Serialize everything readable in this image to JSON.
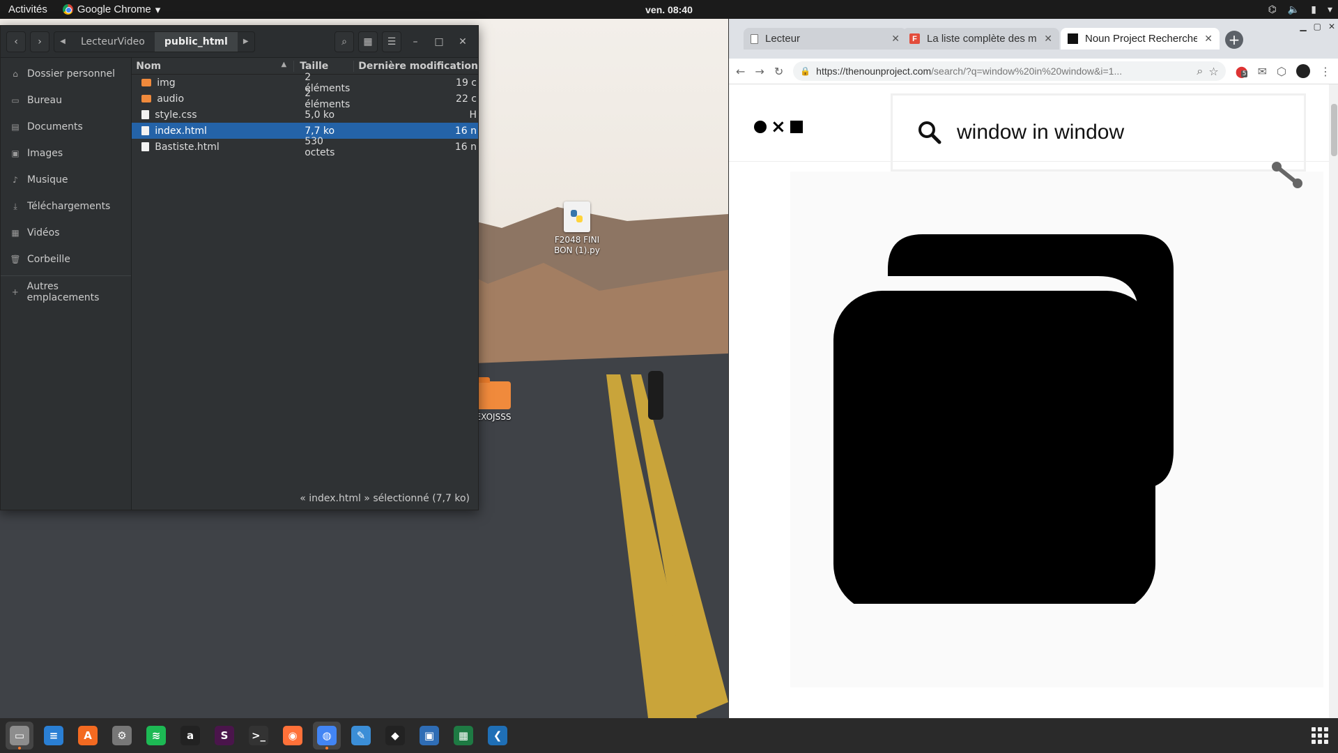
{
  "topbar": {
    "activities": "Activités",
    "app_name": "Google Chrome",
    "app_caret": "▾",
    "clock": "ven. 08:40"
  },
  "desktop": {
    "icons": [
      {
        "label": "F2048 FINI BON (1).py"
      },
      {
        "label": "EXOJSSS"
      }
    ]
  },
  "files": {
    "nav_back": "‹",
    "nav_forward": "›",
    "path": [
      "LecteurVideo",
      "public_html"
    ],
    "sidebar": [
      {
        "label": "Dossier personnel",
        "icon": "home-icon",
        "glyph": "⌂"
      },
      {
        "label": "Bureau",
        "icon": "desktop-icon",
        "glyph": "▭"
      },
      {
        "label": "Documents",
        "icon": "documents-icon",
        "glyph": "▤"
      },
      {
        "label": "Images",
        "icon": "images-icon",
        "glyph": "▣"
      },
      {
        "label": "Musique",
        "icon": "music-icon",
        "glyph": "♪"
      },
      {
        "label": "Téléchargements",
        "icon": "download-icon",
        "glyph": "⤓"
      },
      {
        "label": "Vidéos",
        "icon": "videos-icon",
        "glyph": "▦"
      },
      {
        "label": "Corbeille",
        "icon": "trash-icon",
        "glyph": "🗑"
      }
    ],
    "other_locations": "Autres emplacements",
    "other_glyph": "+",
    "columns": {
      "name": "Nom",
      "size": "Taille",
      "date": "Dernière modification"
    },
    "rows": [
      {
        "name": "img",
        "size": "2 éléments",
        "date": "19 c",
        "type": "folder"
      },
      {
        "name": "audio",
        "size": "2 éléments",
        "date": "22 c",
        "type": "folder"
      },
      {
        "name": "style.css",
        "size": "5,0 ko",
        "date": "H",
        "type": "file"
      },
      {
        "name": "index.html",
        "size": "7,7 ko",
        "date": "16 n",
        "type": "file",
        "selected": true
      },
      {
        "name": "Bastiste.html",
        "size": "530 octets",
        "date": "16 n",
        "type": "file"
      }
    ],
    "status": "« index.html » sélectionné (7,7 ko)"
  },
  "chrome": {
    "tabs": [
      {
        "title": "Lecteur",
        "favicon": "document-icon"
      },
      {
        "title": "La liste complète des me",
        "favicon": "f-icon"
      },
      {
        "title": "Noun Project Recherche",
        "favicon": "nounproject-icon",
        "active": true
      }
    ],
    "tab_close": "✕",
    "new_tab": "+",
    "url_host": "https://thenounproject.com",
    "url_path": "/search/?q=window%20in%20window&i=1...",
    "badge_count": "5"
  },
  "page": {
    "search_query": "window in window"
  },
  "dock": [
    {
      "name": "files-icon",
      "color": "#8d8d8d",
      "glyph": "▭",
      "active": true
    },
    {
      "name": "writer-icon",
      "color": "#2a7fd4",
      "glyph": "≡",
      "active": false
    },
    {
      "name": "software-center-icon",
      "color": "#f36a21",
      "glyph": "A",
      "active": false
    },
    {
      "name": "settings-icon",
      "color": "#777777",
      "glyph": "⚙",
      "active": false
    },
    {
      "name": "spotify-icon",
      "color": "#1db954",
      "glyph": "≋",
      "active": false
    },
    {
      "name": "amazon-icon",
      "color": "#222222",
      "glyph": "a",
      "active": false
    },
    {
      "name": "slack-icon",
      "color": "#4a154b",
      "glyph": "S",
      "active": false
    },
    {
      "name": "terminal-icon",
      "color": "#333333",
      "glyph": ">_",
      "active": false
    },
    {
      "name": "firefox-icon",
      "color": "#ff7139",
      "glyph": "◉",
      "active": false
    },
    {
      "name": "chrome-icon",
      "color": "#4285f4",
      "glyph": "◍",
      "active": true
    },
    {
      "name": "text-editor-icon",
      "color": "#3b8ed7",
      "glyph": "✎",
      "active": false
    },
    {
      "name": "inkscape-icon",
      "color": "#222222",
      "glyph": "◆",
      "active": false
    },
    {
      "name": "virtualbox-icon",
      "color": "#2f6db5",
      "glyph": "▣",
      "active": false
    },
    {
      "name": "spreadsheet-icon",
      "color": "#1e7a43",
      "glyph": "▦",
      "active": false
    },
    {
      "name": "vscode-icon",
      "color": "#1f6fb6",
      "glyph": "❮",
      "active": false
    }
  ]
}
